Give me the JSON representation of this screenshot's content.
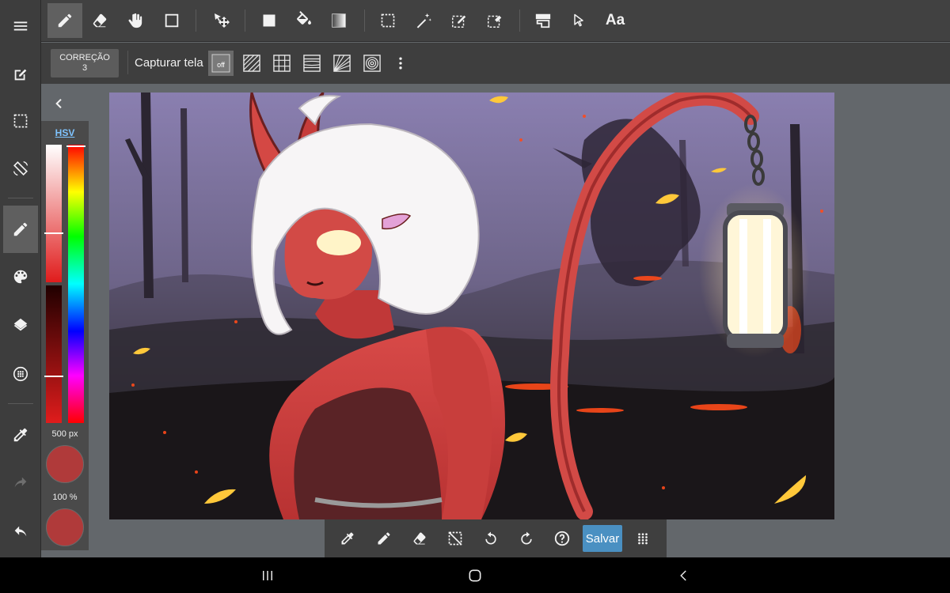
{
  "toolbar": {
    "tools": [
      "pencil-icon",
      "eraser-icon",
      "hand-icon",
      "square-icon",
      "move-transform-icon",
      "fill-rect-icon",
      "paint-bucket-icon",
      "gradient-icon",
      "select-rect-icon",
      "magic-wand-icon",
      "select-pen-icon",
      "select-eraser-icon",
      "layer-move-icon",
      "select-arrow-icon",
      "text-icon"
    ],
    "text_tool_label": "Aa"
  },
  "subbar": {
    "correction_label": "CORREÇÃO",
    "correction_value": "3",
    "capture_label": "Capturar tela",
    "guide_off_label": "off"
  },
  "color_panel": {
    "mode_label": "HSV",
    "brush_size": "500 px",
    "opacity": "100 %",
    "main_color": "#b03a3a",
    "secondary_color": "#b03a3a"
  },
  "bottombar": {
    "save_label": "Salvar"
  },
  "colors": {
    "accent": "#4a90c2",
    "toolbar_bg": "#414141"
  }
}
